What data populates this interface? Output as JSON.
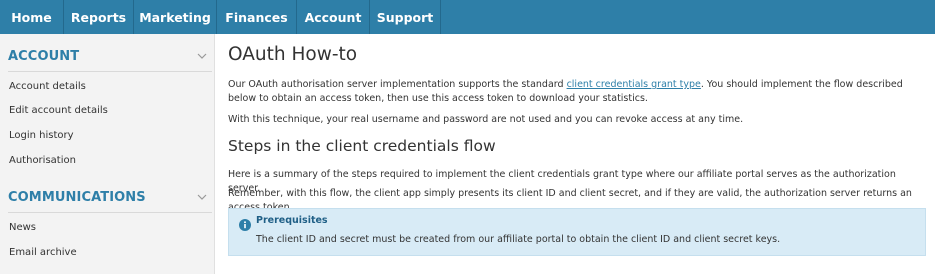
{
  "topnav": {
    "items": [
      {
        "label": "Home"
      },
      {
        "label": "Reports"
      },
      {
        "label": "Marketing"
      },
      {
        "label": "Finances"
      },
      {
        "label": "Account"
      },
      {
        "label": "Support"
      }
    ]
  },
  "sidebar": {
    "sections": [
      {
        "title": "ACCOUNT",
        "items": [
          {
            "label": "Account details"
          },
          {
            "label": "Edit account details"
          },
          {
            "label": "Login history"
          },
          {
            "label": "Authorisation"
          }
        ]
      },
      {
        "title": "COMMUNICATIONS",
        "items": [
          {
            "label": "News"
          },
          {
            "label": "Email archive"
          }
        ]
      }
    ]
  },
  "main": {
    "title": "OAuth How-to",
    "intro": {
      "before_link": "Our OAuth authorisation server implementation supports the standard ",
      "link_text": "client credentials grant type",
      "after_link": ". You should implement the flow described below to obtain an access token, then use this access token to download your statistics."
    },
    "technique_text": "With this technique, your real username and password are not used and you can revoke access at any time.",
    "steps_heading": "Steps in the client credentials flow",
    "steps_summary": "Here is a summary of the steps required to implement the client credentials grant type where our affiliate portal serves as the authorization server.",
    "steps_remember": "Remember, with this flow, the client app simply presents its client ID and client secret, and if they are valid, the authorization server returns an access token.",
    "callout": {
      "title": "Prerequisites",
      "text": "The client ID and secret must be created from our affiliate portal to obtain the client ID and client secret keys."
    }
  },
  "colors": {
    "nav_bg": "#2e7fa8",
    "accent": "#2e7fa8",
    "callout_bg": "#d8ebf6",
    "sidebar_bg": "#f3f3f3"
  },
  "icons": {
    "section_toggle": "chevron-down-icon",
    "callout": "info-icon"
  }
}
